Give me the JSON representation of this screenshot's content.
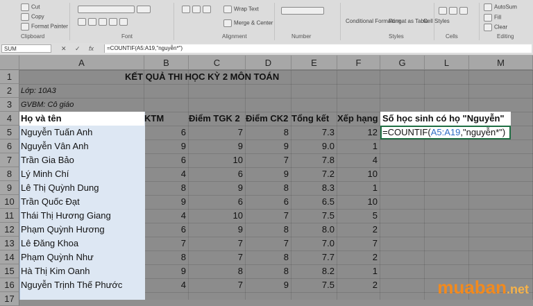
{
  "ribbon": {
    "clipboard": {
      "cut": "Cut",
      "copy": "Copy",
      "format_painter": "Format Painter",
      "group": "Clipboard"
    },
    "font": {
      "group": "Font"
    },
    "alignment": {
      "wrap_text": "Wrap Text",
      "merge": "Merge & Center",
      "group": "Alignment"
    },
    "number": {
      "group": "Number"
    },
    "styles": {
      "conditional": "Conditional Formatting",
      "format_table": "Format as Table",
      "cell_styles": "Cell Styles",
      "group": "Styles"
    },
    "cells": {
      "group": "Cells"
    },
    "editing": {
      "autosum": "AutoSum",
      "fill": "Fill",
      "clear": "Clear",
      "group": "Editing"
    }
  },
  "formula_bar": {
    "name_box": "SUM",
    "cancel": "✕",
    "enter": "✓",
    "fx": "fx",
    "formula": "=COUNTIF(A5:A19,\"nguyễn*\")"
  },
  "columns": [
    "A",
    "B",
    "C",
    "D",
    "E",
    "F",
    "G",
    "L",
    "M"
  ],
  "rows": [
    "1",
    "2",
    "3",
    "4",
    "5",
    "6",
    "7",
    "8",
    "9",
    "10",
    "11",
    "12",
    "13",
    "14",
    "15",
    "16",
    "17"
  ],
  "sheet": {
    "title": "KẾT QUẢ THI HỌC KỲ 2 MÔN TOÁN",
    "class_line": "Lớp: 10A3",
    "teacher_line": "GVBM: Cô giáo",
    "headers": {
      "name": "Họ và tên",
      "ktm": "KTM",
      "tgk": "Điểm TGK 2",
      "ck": "Điểm CK2",
      "total": "Tổng kết",
      "rank": "Xếp hạng",
      "g": "Số học sinh có họ \"Nguyễn\""
    },
    "formula_cell": {
      "prefix": "=COUNTIF(",
      "range": "A5:A19",
      "suffix": ",\"nguyễn*\")"
    },
    "data": [
      {
        "name": "Nguyễn Tuấn Anh",
        "ktm": "6",
        "tgk": "7",
        "ck": "8",
        "total": "7.3",
        "rank": "12"
      },
      {
        "name": "Nguyễn Vân Anh",
        "ktm": "9",
        "tgk": "9",
        "ck": "9",
        "total": "9.0",
        "rank": "1"
      },
      {
        "name": "Trần Gia Bảo",
        "ktm": "6",
        "tgk": "10",
        "ck": "7",
        "total": "7.8",
        "rank": "4"
      },
      {
        "name": "Lý Minh Chí",
        "ktm": "4",
        "tgk": "6",
        "ck": "9",
        "total": "7.2",
        "rank": "10"
      },
      {
        "name": "Lê Thị Quỳnh Dung",
        "ktm": "8",
        "tgk": "9",
        "ck": "8",
        "total": "8.3",
        "rank": "1"
      },
      {
        "name": "Trần Quốc Đạt",
        "ktm": "9",
        "tgk": "6",
        "ck": "6",
        "total": "6.5",
        "rank": "10"
      },
      {
        "name": "Thái Thị Hương Giang",
        "ktm": "4",
        "tgk": "10",
        "ck": "7",
        "total": "7.5",
        "rank": "5"
      },
      {
        "name": "Phạm Quỳnh Hương",
        "ktm": "6",
        "tgk": "9",
        "ck": "8",
        "total": "8.0",
        "rank": "2"
      },
      {
        "name": "Lê Đăng Khoa",
        "ktm": "7",
        "tgk": "7",
        "ck": "7",
        "total": "7.0",
        "rank": "7"
      },
      {
        "name": "Phạm Quỳnh Như",
        "ktm": "8",
        "tgk": "7",
        "ck": "8",
        "total": "7.7",
        "rank": "2"
      },
      {
        "name": "Hà Thị Kim Oanh",
        "ktm": "9",
        "tgk": "8",
        "ck": "8",
        "total": "8.2",
        "rank": "1"
      },
      {
        "name": "Nguyễn Trịnh Thế Phước",
        "ktm": "4",
        "tgk": "7",
        "ck": "9",
        "total": "7.5",
        "rank": "2"
      }
    ]
  },
  "logo": {
    "part1": "muaban",
    "part2": ".net"
  },
  "colors": {
    "accent_green": "#1e6e43",
    "range_blue": "#2f6dc4",
    "logo_orange": "#f28a1e"
  }
}
